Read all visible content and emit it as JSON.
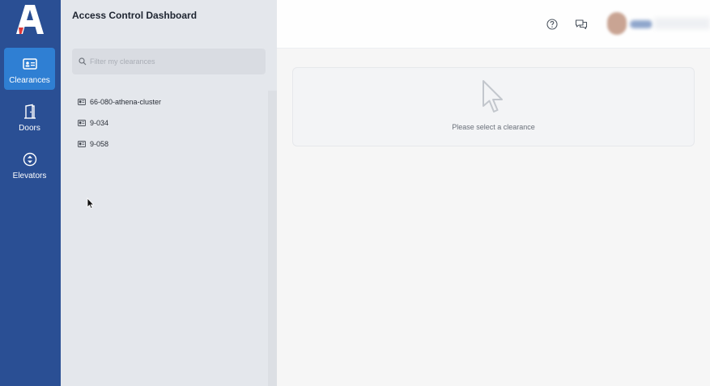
{
  "nav": {
    "items": [
      {
        "label": "Clearances",
        "icon": "id-card-icon",
        "active": true
      },
      {
        "label": "Doors",
        "icon": "door-icon",
        "active": false
      },
      {
        "label": "Elevators",
        "icon": "elevator-icon",
        "active": false
      }
    ]
  },
  "panel": {
    "title": "Access Control Dashboard",
    "search_placeholder": "Filter my clearances",
    "clearances": [
      "66-080-athena-cluster",
      "9-034",
      "9-058"
    ]
  },
  "main": {
    "empty_message": "Please select a clearance"
  },
  "colors": {
    "rail": "#2a4f94",
    "active_nav": "#2f7fd3"
  }
}
